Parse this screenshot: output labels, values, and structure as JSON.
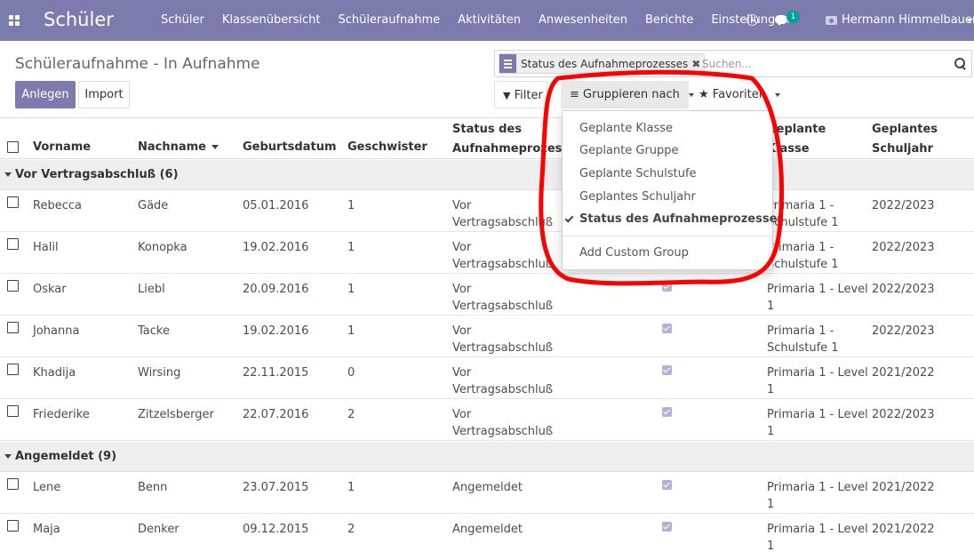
{
  "navbar": {
    "brand": "Schüler",
    "menu": [
      "Schüler",
      "Klassenübersicht",
      "Schüleraufnahme",
      "Aktivitäten",
      "Anwesenheiten",
      "Berichte",
      "Einstellungen"
    ],
    "chat_badge": "1",
    "user_name": "Hermann Himmelbauer",
    "colors": {
      "navbar": "#7c7bad",
      "badge": "#00a09d"
    }
  },
  "control_panel": {
    "title": "Schüleraufnahme - In Aufnahme",
    "create_label": "Anlegen",
    "import_label": "Import",
    "search": {
      "facet": "Status des Aufnahmeprozesses",
      "placeholder": "Suchen..."
    },
    "filter_label": "Filter",
    "group_by_label": "Gruppieren nach",
    "favorites_label": "Favoriten"
  },
  "group_by_dropdown": {
    "items": [
      {
        "label": "Geplante Klasse",
        "selected": false
      },
      {
        "label": "Geplante Gruppe",
        "selected": false
      },
      {
        "label": "Geplante Schulstufe",
        "selected": false
      },
      {
        "label": "Geplantes Schuljahr",
        "selected": false
      },
      {
        "label": "Status des Aufnahmeprozesses",
        "selected": true
      }
    ],
    "custom_group_label": "Add Custom Group"
  },
  "table": {
    "columns": {
      "vorname": "Vorname",
      "nachname": "Nachname",
      "geburtsdatum": "Geburtsdatum",
      "geschwister": "Geschwister",
      "status_1": "Status des",
      "status_2": "Aufnahmeprozesses",
      "klasse_1": "Geplante",
      "klasse_2": "Klasse",
      "schuljahr_1": "Geplantes",
      "schuljahr_2": "Schuljahr"
    },
    "groups": [
      {
        "label": "Vor Vertragsabschluß (6)",
        "rows": [
          {
            "vorname": "Rebecca",
            "nachname": "Gäde",
            "geburtsdatum": "05.01.2016",
            "geschwister": "1",
            "status_1": "Vor",
            "status_2": "Vertragsabschluß",
            "klasse_1": "Primaria 1 -",
            "klasse_2": "Schulstufe 1",
            "schuljahr": "2022/2023"
          },
          {
            "vorname": "Halil",
            "nachname": "Konopka",
            "geburtsdatum": "19.02.2016",
            "geschwister": "1",
            "status_1": "Vor",
            "status_2": "Vertragsabschluß",
            "klasse_1": "Primaria 1 -",
            "klasse_2": "Schulstufe 1",
            "schuljahr": "2022/2023"
          },
          {
            "vorname": "Oskar",
            "nachname": "Liebl",
            "geburtsdatum": "20.09.2016",
            "geschwister": "1",
            "status_1": "Vor",
            "status_2": "Vertragsabschluß",
            "klasse_1": "Primaria 1 - Level",
            "klasse_2": "1",
            "schuljahr": "2022/2023"
          },
          {
            "vorname": "Johanna",
            "nachname": "Tacke",
            "geburtsdatum": "19.02.2016",
            "geschwister": "1",
            "status_1": "Vor",
            "status_2": "Vertragsabschluß",
            "klasse_1": "Primaria 1 -",
            "klasse_2": "Schulstufe 1",
            "schuljahr": "2022/2023"
          },
          {
            "vorname": "Khadija",
            "nachname": "Wirsing",
            "geburtsdatum": "22.11.2015",
            "geschwister": "0",
            "status_1": "Vor",
            "status_2": "Vertragsabschluß",
            "klasse_1": "Primaria 1 - Level",
            "klasse_2": "1",
            "schuljahr": "2021/2022"
          },
          {
            "vorname": "Friederike",
            "nachname": "Zitzelsberger",
            "geburtsdatum": "22.07.2016",
            "geschwister": "2",
            "status_1": "Vor",
            "status_2": "Vertragsabschluß",
            "klasse_1": "Primaria 1 - Level",
            "klasse_2": "1",
            "schuljahr": "2022/2023"
          }
        ]
      },
      {
        "label": "Angemeldet (9)",
        "rows": [
          {
            "vorname": "Lene",
            "nachname": "Benn",
            "geburtsdatum": "23.07.2015",
            "geschwister": "1",
            "status_1": "Angemeldet",
            "status_2": "",
            "klasse_1": "Primaria 1 - Level",
            "klasse_2": "1",
            "schuljahr": "2021/2022"
          },
          {
            "vorname": "Maja",
            "nachname": "Denker",
            "geburtsdatum": "09.12.2015",
            "geschwister": "2",
            "status_1": "Angemeldet",
            "status_2": "",
            "klasse_1": "Primaria 1 - Level",
            "klasse_2": "1",
            "schuljahr": "2021/2022"
          }
        ]
      }
    ]
  },
  "annotation_color": "#ff0000"
}
